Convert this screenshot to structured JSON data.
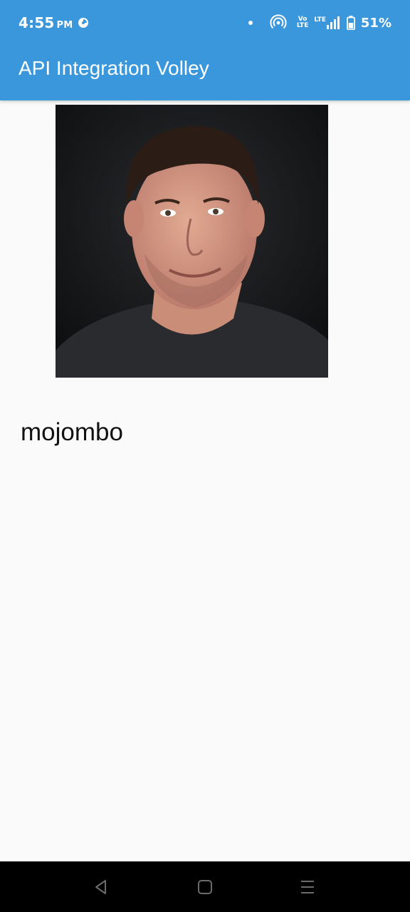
{
  "status_bar": {
    "time": "4:55",
    "ampm": "PM",
    "volte": "Vo LTE",
    "lte": "LTE",
    "battery_percent": "51%",
    "icons": [
      "data-saver-icon",
      "notification-dot-icon",
      "hotspot-icon",
      "volte-icon",
      "lte-signal-icon",
      "battery-icon"
    ]
  },
  "app_bar": {
    "title": "API Integration Volley"
  },
  "profile": {
    "avatar_icon": "user-avatar-photo",
    "username": "mojombo"
  },
  "nav_bar": {
    "icons": [
      "back-icon",
      "home-icon",
      "menu-icon"
    ]
  },
  "colors": {
    "primary": "#3a97dc",
    "background": "#fafafa",
    "nav_bar": "#000000"
  }
}
